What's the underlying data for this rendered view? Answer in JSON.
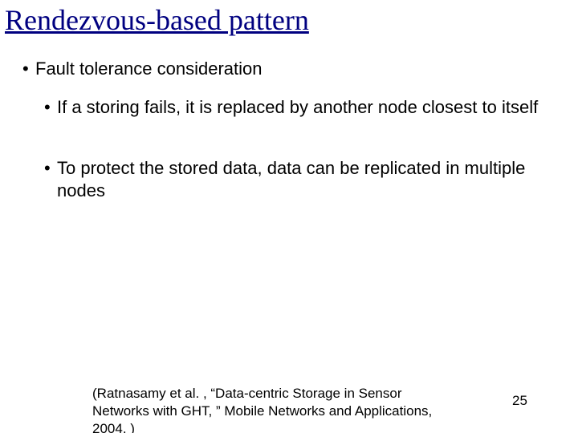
{
  "title": "Rendezvous-based pattern",
  "bullets": {
    "b1": "Fault tolerance consideration",
    "b1a": "If a storing fails, it is replaced by another node closest to itself",
    "b1b": "To protect the stored data, data can be replicated in multiple nodes"
  },
  "citation": "(Ratnasamy et al. , “Data-centric Storage in Sensor Networks with GHT, ” Mobile Networks and Applications, 2004. )",
  "page_number": "25",
  "bullet_char": "•"
}
